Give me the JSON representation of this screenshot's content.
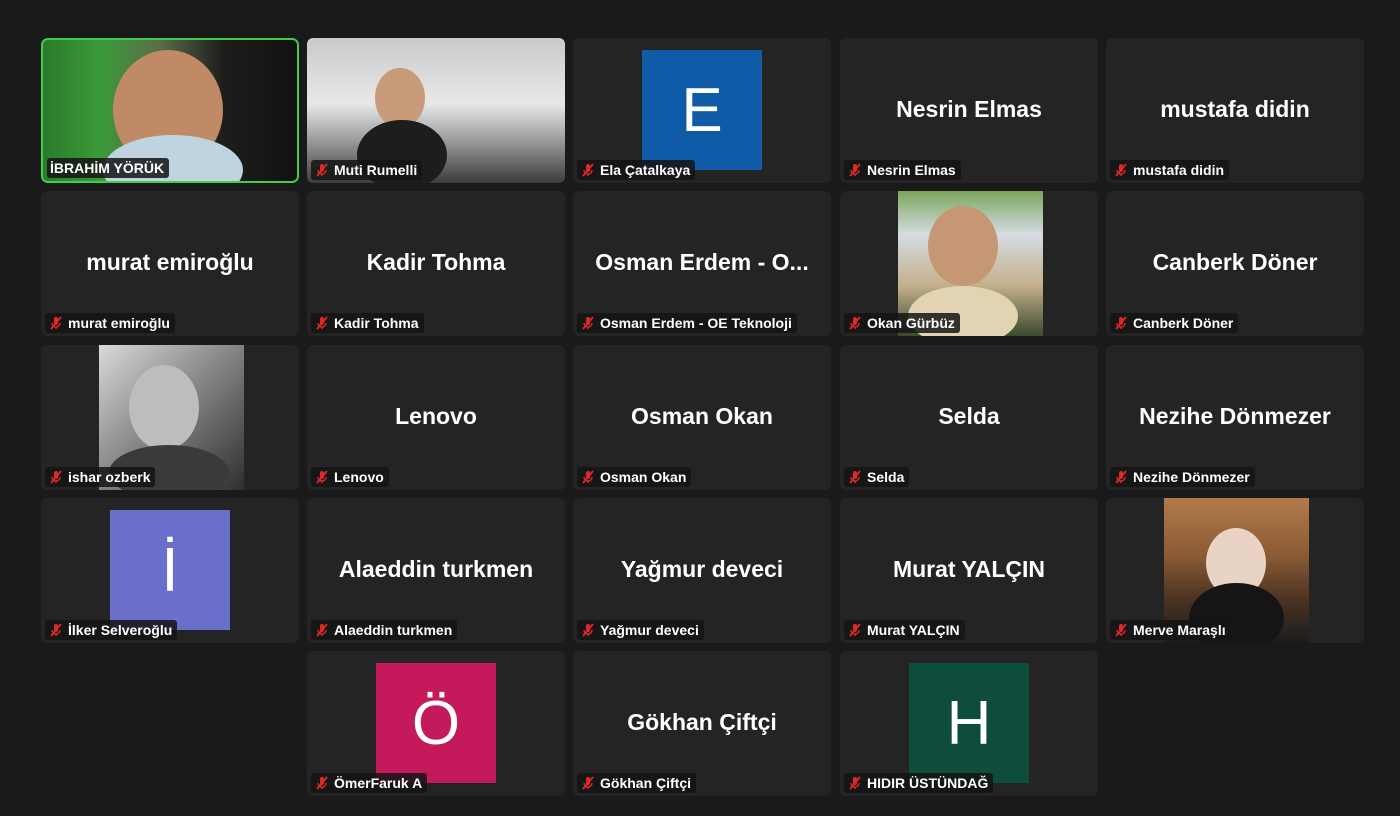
{
  "participants": [
    {
      "name": "İBRAHİM YÖRÜK",
      "display": "",
      "tile": "photo",
      "photo": "ibrahim",
      "active": true,
      "muted": false
    },
    {
      "name": "Muti Rumelli",
      "display": "",
      "tile": "photo",
      "photo": "muti",
      "active": false,
      "muted": true
    },
    {
      "name": "Ela Çatalkaya",
      "display": "E",
      "tile": "avatar",
      "color": "#0f5ba8",
      "muted": true
    },
    {
      "name": "Nesrin Elmas",
      "display": "Nesrin Elmas",
      "tile": "text",
      "muted": true
    },
    {
      "name": "mustafa didin",
      "display": "mustafa didin",
      "tile": "text",
      "muted": true
    },
    {
      "name": "murat emiroğlu",
      "display": "murat emiroğlu",
      "tile": "text",
      "muted": true
    },
    {
      "name": "Kadir Tohma",
      "display": "Kadir Tohma",
      "tile": "text",
      "muted": true
    },
    {
      "name": "Osman Erdem - OE Teknoloji",
      "display": "Osman Erdem - O...",
      "tile": "text",
      "muted": true
    },
    {
      "name": "Okan Gürbüz",
      "display": "",
      "tile": "photo",
      "photo": "okan",
      "muted": true
    },
    {
      "name": "Canberk Döner",
      "display": "Canberk Döner",
      "tile": "text",
      "muted": true
    },
    {
      "name": "ishar ozberk",
      "display": "",
      "tile": "photo",
      "photo": "ishar",
      "muted": true
    },
    {
      "name": "Lenovo",
      "display": "Lenovo",
      "tile": "text",
      "muted": true
    },
    {
      "name": "Osman Okan",
      "display": "Osman Okan",
      "tile": "text",
      "muted": true
    },
    {
      "name": "Selda",
      "display": "Selda",
      "tile": "text",
      "muted": true
    },
    {
      "name": "Nezihe Dönmezer",
      "display": "Nezihe Dönmezer",
      "tile": "text",
      "muted": true
    },
    {
      "name": "İlker Selveroğlu",
      "display": "İ",
      "tile": "avatar",
      "color": "#6a6fcb",
      "muted": true
    },
    {
      "name": "Alaeddin turkmen",
      "display": "Alaeddin turkmen",
      "tile": "text",
      "muted": true
    },
    {
      "name": "Yağmur deveci",
      "display": "Yağmur deveci",
      "tile": "text",
      "muted": true
    },
    {
      "name": "Murat YALÇIN",
      "display": "Murat YALÇIN",
      "tile": "text",
      "muted": true
    },
    {
      "name": "Merve Maraşlı",
      "display": "",
      "tile": "photo",
      "photo": "merve",
      "muted": true
    },
    {
      "name": "ÖmerFaruk A",
      "display": "Ö",
      "tile": "avatar",
      "color": "#c4195a",
      "muted": true
    },
    {
      "name": "Gökhan Çiftçi",
      "display": "Gökhan Çiftçi",
      "tile": "text",
      "muted": true
    },
    {
      "name": "HIDIR ÜSTÜNDAĞ",
      "display": "H",
      "tile": "avatar",
      "color": "#0e4d3b",
      "muted": true
    }
  ],
  "colors": {
    "background": "#1a1a1a",
    "tile": "#242424",
    "active_border": "#3fd04a",
    "muted_icon": "#e02828"
  },
  "icons": {
    "muted": "mic-muted-icon"
  }
}
